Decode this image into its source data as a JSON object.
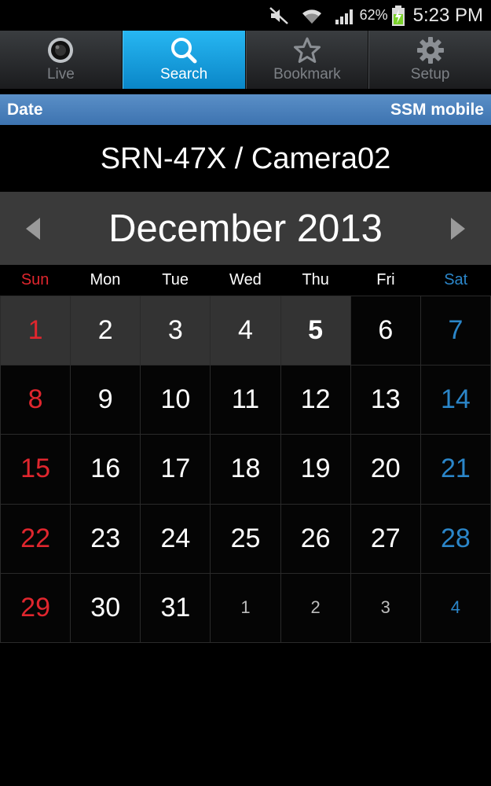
{
  "status_bar": {
    "battery_percent": "62%",
    "time": "5:23 PM"
  },
  "tabs": [
    {
      "label": "Live",
      "icon": "camera-lens-icon",
      "active": false
    },
    {
      "label": "Search",
      "icon": "search-icon",
      "active": true
    },
    {
      "label": "Bookmark",
      "icon": "star-icon",
      "active": false
    },
    {
      "label": "Setup",
      "icon": "gear-icon",
      "active": false
    }
  ],
  "section": {
    "left": "Date",
    "right": "SSM mobile"
  },
  "camera": {
    "title": "SRN-47X / Camera02"
  },
  "calendar": {
    "month_title": "December 2013",
    "weekdays": [
      "Sun",
      "Mon",
      "Tue",
      "Wed",
      "Thu",
      "Fri",
      "Sat"
    ],
    "colors": {
      "sunday": "#e0262e",
      "saturday": "#2b86c9",
      "highlight": "#333333",
      "active_tab": "#1aa3e0"
    },
    "weeks": [
      [
        "1",
        "2",
        "3",
        "4",
        "5",
        "6",
        "7"
      ],
      [
        "8",
        "9",
        "10",
        "11",
        "12",
        "13",
        "14"
      ],
      [
        "15",
        "16",
        "17",
        "18",
        "19",
        "20",
        "21"
      ],
      [
        "22",
        "23",
        "24",
        "25",
        "26",
        "27",
        "28"
      ],
      [
        "29",
        "30",
        "31",
        "1",
        "2",
        "3",
        "4"
      ]
    ]
  }
}
